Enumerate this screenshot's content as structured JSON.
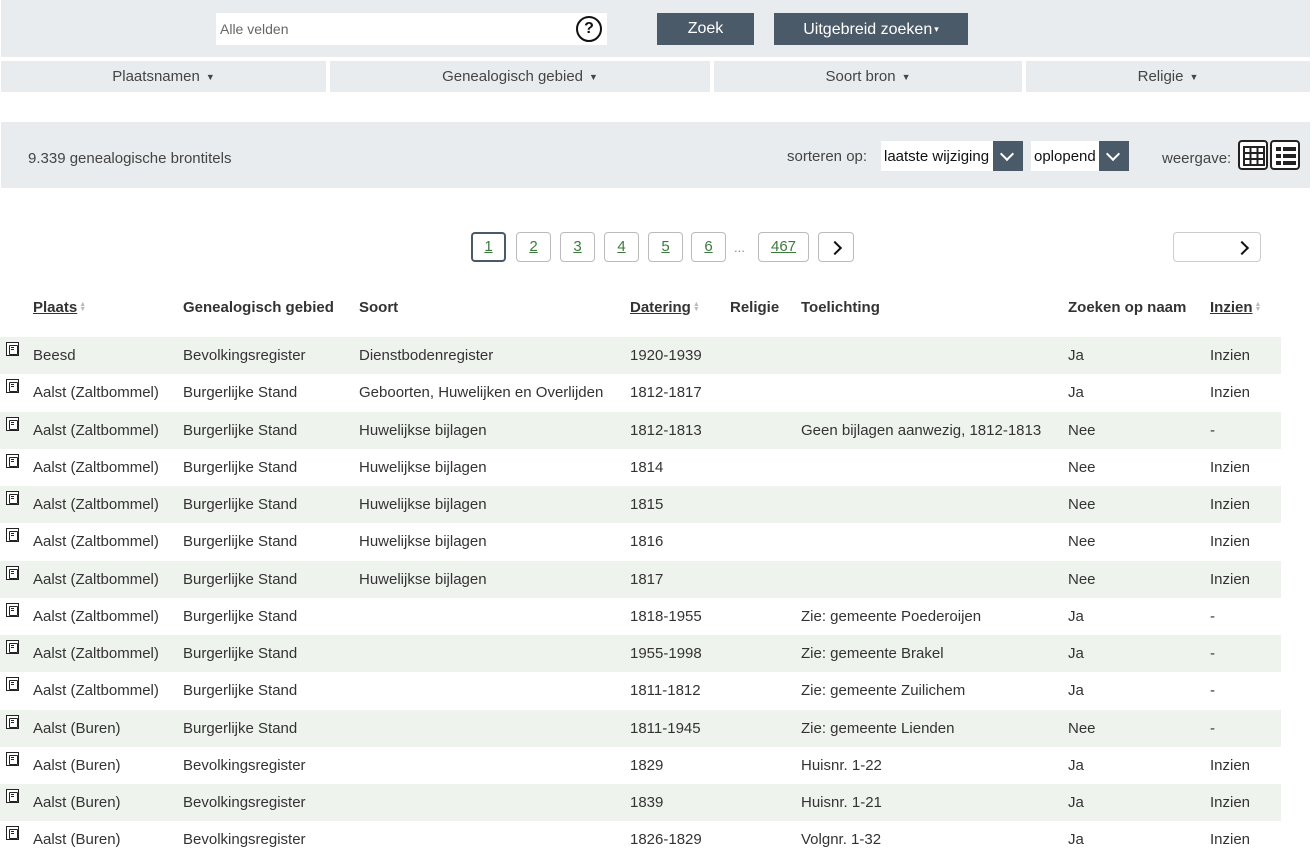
{
  "search": {
    "placeholder": "Alle velden",
    "help_glyph": "?",
    "zoek_label": "Zoek",
    "uitgebreid_label": "Uitgebreid zoeken",
    "uitgebreid_caret": "▾"
  },
  "filters": [
    {
      "label": "Plaatsnamen"
    },
    {
      "label": "Genealogisch gebied"
    },
    {
      "label": "Soort bron"
    },
    {
      "label": "Religie"
    }
  ],
  "results": {
    "count_text": "9.339  genealogische brontitels",
    "sort_label": "sorteren op:",
    "sort_field": "laatste wijziging",
    "sort_order": "oplopend",
    "view_label": "weergave:"
  },
  "pager": {
    "pages": [
      "1",
      "2",
      "3",
      "4",
      "5",
      "6"
    ],
    "ellipsis": "...",
    "last": "467"
  },
  "table": {
    "headers": {
      "plaats": "Plaats",
      "gebied": "Genealogisch gebied",
      "soort": "Soort",
      "datering": "Datering",
      "religie": "Religie",
      "toelichting": "Toelichting",
      "zoeken": "Zoeken op naam",
      "inzien": "Inzien"
    },
    "rows": [
      {
        "plaats": "Beesd",
        "gebied": "Bevolkingsregister",
        "soort": "Dienstbodenregister",
        "datering": "1920-1939",
        "religie": "",
        "toelichting": "",
        "zoeken": "Ja",
        "inzien": "Inzien"
      },
      {
        "plaats": "Aalst (Zaltbommel)",
        "gebied": "Burgerlijke Stand",
        "soort": "Geboorten, Huwelijken en Overlijden",
        "datering": "1812-1817",
        "religie": "",
        "toelichting": "",
        "zoeken": "Ja",
        "inzien": "Inzien"
      },
      {
        "plaats": "Aalst (Zaltbommel)",
        "gebied": "Burgerlijke Stand",
        "soort": "Huwelijkse bijlagen",
        "datering": "1812-1813",
        "religie": "",
        "toelichting": "Geen bijlagen aanwezig, 1812-1813",
        "zoeken": "Nee",
        "inzien": "-"
      },
      {
        "plaats": "Aalst (Zaltbommel)",
        "gebied": "Burgerlijke Stand",
        "soort": "Huwelijkse bijlagen",
        "datering": "1814",
        "religie": "",
        "toelichting": "",
        "zoeken": "Nee",
        "inzien": "Inzien"
      },
      {
        "plaats": "Aalst (Zaltbommel)",
        "gebied": "Burgerlijke Stand",
        "soort": "Huwelijkse bijlagen",
        "datering": "1815",
        "religie": "",
        "toelichting": "",
        "zoeken": "Nee",
        "inzien": "Inzien"
      },
      {
        "plaats": "Aalst (Zaltbommel)",
        "gebied": "Burgerlijke Stand",
        "soort": "Huwelijkse bijlagen",
        "datering": "1816",
        "religie": "",
        "toelichting": "",
        "zoeken": "Nee",
        "inzien": "Inzien"
      },
      {
        "plaats": "Aalst (Zaltbommel)",
        "gebied": "Burgerlijke Stand",
        "soort": "Huwelijkse bijlagen",
        "datering": "1817",
        "religie": "",
        "toelichting": "",
        "zoeken": "Nee",
        "inzien": "Inzien"
      },
      {
        "plaats": "Aalst (Zaltbommel)",
        "gebied": "Burgerlijke Stand",
        "soort": "",
        "datering": "1818-1955",
        "religie": "",
        "toelichting": "Zie: gemeente Poederoijen",
        "zoeken": "Ja",
        "inzien": "-"
      },
      {
        "plaats": "Aalst (Zaltbommel)",
        "gebied": "Burgerlijke Stand",
        "soort": "",
        "datering": "1955-1998",
        "religie": "",
        "toelichting": "Zie: gemeente Brakel",
        "zoeken": "Ja",
        "inzien": "-"
      },
      {
        "plaats": "Aalst (Zaltbommel)",
        "gebied": "Burgerlijke Stand",
        "soort": "",
        "datering": "1811-1812",
        "religie": "",
        "toelichting": "Zie: gemeente Zuilichem",
        "zoeken": "Ja",
        "inzien": "-"
      },
      {
        "plaats": "Aalst (Buren)",
        "gebied": "Burgerlijke Stand",
        "soort": "",
        "datering": "1811-1945",
        "religie": "",
        "toelichting": "Zie: gemeente Lienden",
        "zoeken": "Nee",
        "inzien": "-"
      },
      {
        "plaats": "Aalst (Buren)",
        "gebied": "Bevolkingsregister",
        "soort": "",
        "datering": "1829",
        "religie": "",
        "toelichting": "Huisnr. 1-22",
        "zoeken": "Ja",
        "inzien": "Inzien"
      },
      {
        "plaats": "Aalst (Buren)",
        "gebied": "Bevolkingsregister",
        "soort": "",
        "datering": "1839",
        "religie": "",
        "toelichting": "Huisnr. 1-21",
        "zoeken": "Ja",
        "inzien": "Inzien"
      },
      {
        "plaats": "Aalst (Buren)",
        "gebied": "Bevolkingsregister",
        "soort": "",
        "datering": "1826-1829",
        "religie": "",
        "toelichting": "Volgnr. 1-32",
        "zoeken": "Ja",
        "inzien": "Inzien"
      }
    ]
  }
}
